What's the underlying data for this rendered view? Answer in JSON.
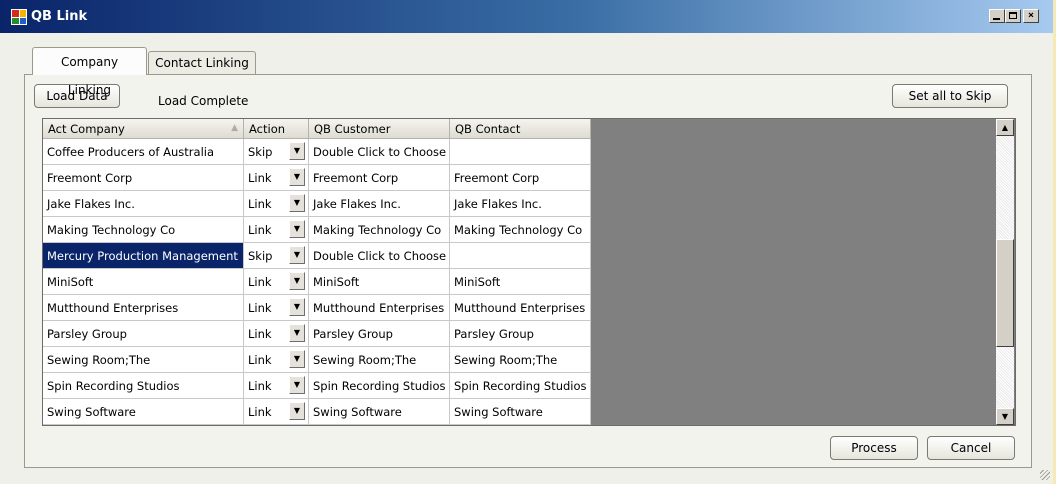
{
  "window": {
    "title": "QB Link"
  },
  "tabs": [
    {
      "label": "Company Linking",
      "active": true
    },
    {
      "label": "Contact Linking",
      "active": false
    }
  ],
  "toolbar": {
    "load_label": "Load Data",
    "status_text": "Load Complete",
    "skip_all_label": "Set all to Skip"
  },
  "grid": {
    "columns": [
      "Act Company",
      "Action",
      "QB Customer",
      "QB Contact"
    ],
    "sorted_column": "Act Company",
    "selected_row_index": 4,
    "rows": [
      {
        "company": "Coffee Producers of Australia",
        "action": "Skip",
        "customer": "Double Click to Choose",
        "contact": ""
      },
      {
        "company": "Freemont Corp",
        "action": "Link",
        "customer": "Freemont Corp",
        "contact": "Freemont Corp"
      },
      {
        "company": "Jake Flakes Inc.",
        "action": "Link",
        "customer": "Jake Flakes Inc.",
        "contact": "Jake Flakes Inc."
      },
      {
        "company": "Making Technology Co",
        "action": "Link",
        "customer": "Making Technology Co",
        "contact": "Making Technology Co"
      },
      {
        "company": "Mercury Production Management",
        "action": "Skip",
        "customer": "Double Click to Choose",
        "contact": ""
      },
      {
        "company": "MiniSoft",
        "action": "Link",
        "customer": "MiniSoft",
        "contact": "MiniSoft"
      },
      {
        "company": "Mutthound Enterprises",
        "action": "Link",
        "customer": "Mutthound Enterprises",
        "contact": "Mutthound Enterprises"
      },
      {
        "company": "Parsley Group",
        "action": "Link",
        "customer": "Parsley Group",
        "contact": "Parsley Group"
      },
      {
        "company": "Sewing Room;The",
        "action": "Link",
        "customer": "Sewing Room;The",
        "contact": "Sewing Room;The"
      },
      {
        "company": "Spin Recording Studios",
        "action": "Link",
        "customer": "Spin Recording Studios",
        "contact": "Spin Recording Studios"
      },
      {
        "company": "Swing Software",
        "action": "Link",
        "customer": "Swing Software",
        "contact": "Swing Software"
      }
    ]
  },
  "footer": {
    "process_label": "Process",
    "cancel_label": "Cancel"
  },
  "icons": {
    "app": "qb-link-app-icon",
    "minimize": "minimize-icon",
    "maximize": "maximize-icon",
    "close": "close-icon",
    "dropdown": "dropdown-arrow-icon",
    "sort": "sort-ascending-icon"
  },
  "colors": {
    "selection": "#0a246a",
    "titlebar": "#0a246a",
    "grid_empty": "#808080"
  }
}
